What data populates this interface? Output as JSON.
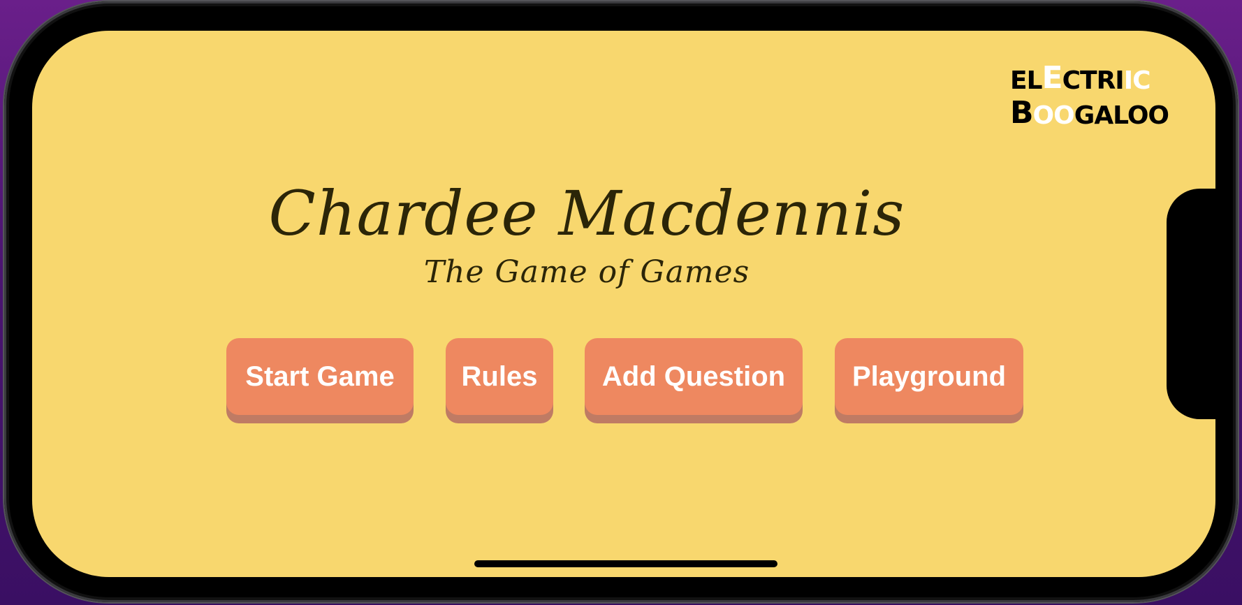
{
  "logo": {
    "row1_parts": [
      "EL",
      "E",
      "CTRI",
      "IC"
    ],
    "row2_parts": [
      "B",
      "OO",
      "GALOO"
    ]
  },
  "title": "Chardee Macdennis",
  "subtitle": "The Game of Games",
  "buttons": {
    "start": "Start Game",
    "rules": "Rules",
    "add": "Add Question",
    "playground": "Playground"
  },
  "colors": {
    "background": "#f8d76e",
    "button": "#ee8860",
    "button_shadow": "#bf7b64",
    "title_text": "#2b2508"
  }
}
